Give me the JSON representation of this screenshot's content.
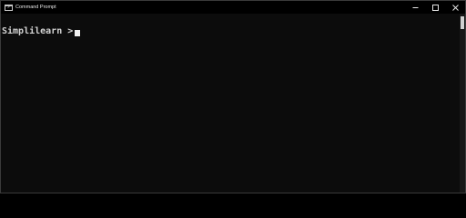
{
  "window": {
    "title": "Command Prompt",
    "accent_color": "#3c78d8"
  },
  "titlebar_controls": [
    {
      "name": "minimize",
      "icon": "minimize-icon"
    },
    {
      "name": "maximize",
      "icon": "maximize-icon"
    },
    {
      "name": "close",
      "icon": "close-icon"
    }
  ],
  "console": {
    "prompt_text": "Simplilearn >",
    "text_color": "#d4d4d4",
    "background": "#0c0c0c"
  }
}
